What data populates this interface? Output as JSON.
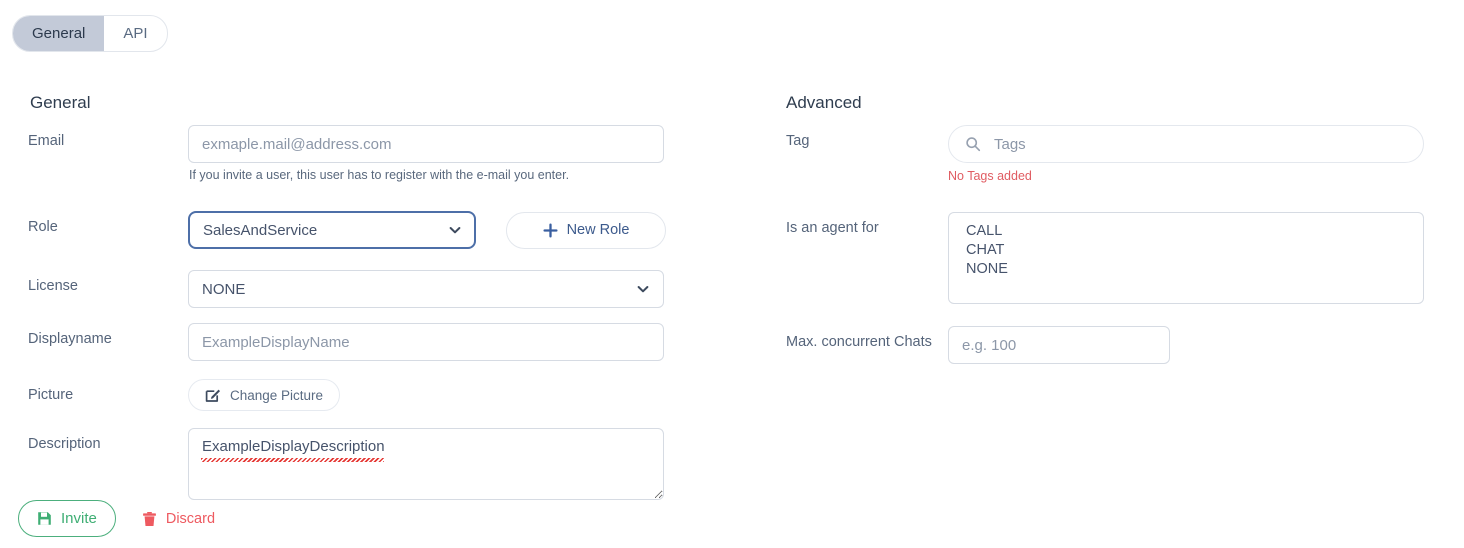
{
  "tabs": [
    {
      "label": "General",
      "active": true
    },
    {
      "label": "API",
      "active": false
    }
  ],
  "general": {
    "section_title": "General",
    "email": {
      "label": "Email",
      "value": "",
      "placeholder": "exmaple.mail@address.com",
      "hint": "If you invite a user, this user has to register with the e-mail you enter."
    },
    "role": {
      "label": "Role",
      "selected": "SalesAndService",
      "options": [
        "SalesAndService"
      ],
      "new_role_button": "New Role",
      "focus_color": "#4d6fa8"
    },
    "license": {
      "label": "License",
      "selected": "NONE",
      "options": [
        "NONE"
      ]
    },
    "displayname": {
      "label": "Displayname",
      "value": "",
      "placeholder": "ExampleDisplayName"
    },
    "picture": {
      "label": "Picture",
      "button_label": "Change Picture"
    },
    "description": {
      "label": "Description",
      "value": "ExampleDisplayDescription"
    }
  },
  "advanced": {
    "section_title": "Advanced",
    "tag": {
      "label": "Tag",
      "value": "",
      "placeholder": "Tags",
      "note": "No Tags added",
      "note_color": "#e05c62"
    },
    "agent_for": {
      "label": "Is an agent for",
      "options": [
        "CALL",
        "CHAT",
        "NONE"
      ],
      "selected": []
    },
    "max_chats": {
      "label": "Max. concurrent Chats",
      "value": "",
      "placeholder": "e.g. 100"
    }
  },
  "footer": {
    "invite_label": "Invite",
    "discard_label": "Discard",
    "invite_color": "#3fae74",
    "discard_color": "#ee5a60"
  }
}
